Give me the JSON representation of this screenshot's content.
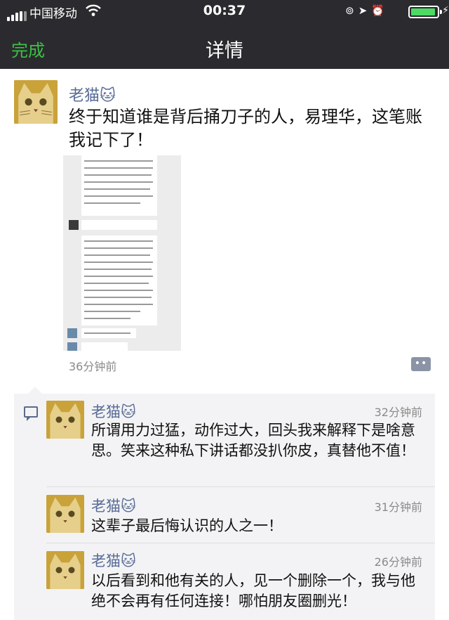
{
  "status_bar": {
    "carrier": "中国移动",
    "time": "00:37"
  },
  "nav": {
    "done_label": "完成",
    "title": "详情"
  },
  "post": {
    "author": "老猫🐱",
    "text": "终于知道谁是背后捅刀子的人，易理华，这笔账我记下了！",
    "time": "36分钟前",
    "more_label": "••"
  },
  "comments": [
    {
      "author": "老猫🐱",
      "time": "32分钟前",
      "text": "所谓用力过猛，动作过大，回头我来解释下是啥意思。笑来这种私下讲话都没扒你皮，真替他不值！"
    },
    {
      "author": "老猫🐱",
      "time": "31分钟前",
      "text": "这辈子最后悔认识的人之一！"
    },
    {
      "author": "老猫🐱",
      "time": "26分钟前",
      "text": "以后看到和他有关的人，见一个删除一个，我与他绝不会再有任何连接！哪怕朋友圈删光！"
    }
  ],
  "colors": {
    "nav_bg": "#2b2b2f",
    "done_green": "#3dc045",
    "name_blue": "#576b95",
    "battery_green": "#4cd964"
  }
}
